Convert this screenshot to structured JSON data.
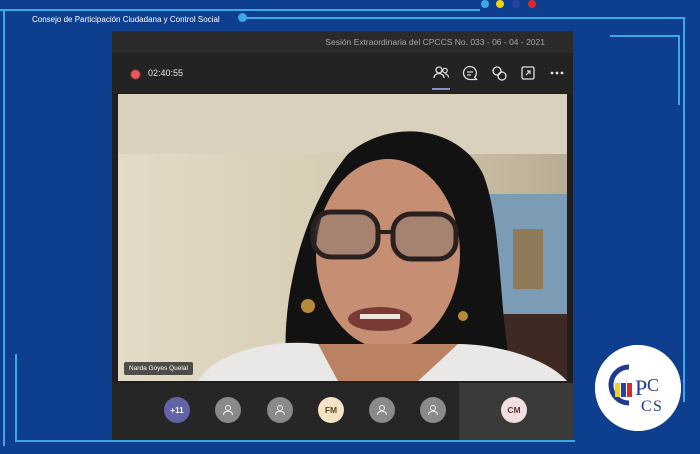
{
  "header": {
    "org_name": "Consejo de Participación Ciudadana y Control Social",
    "flag_colors": [
      "#f5d20f",
      "#2a3fa6",
      "#d92a2a"
    ]
  },
  "meeting": {
    "title": "Sesión Extraordinaria del CPCCS No. 033 - 06 - 04 - 2021",
    "timer": "02:40:55"
  },
  "toolbar": {
    "icons": [
      "participants-icon",
      "chat-icon",
      "reactions-icon",
      "share-tray-icon",
      "more-options-icon"
    ]
  },
  "video": {
    "speaker_name": "Narda Goyes Quelal"
  },
  "participants_strip": {
    "overflow_count": "+11",
    "initials": [
      "FM"
    ],
    "pinned_initials": "CM"
  },
  "logo": {
    "text": "CPCCS"
  }
}
